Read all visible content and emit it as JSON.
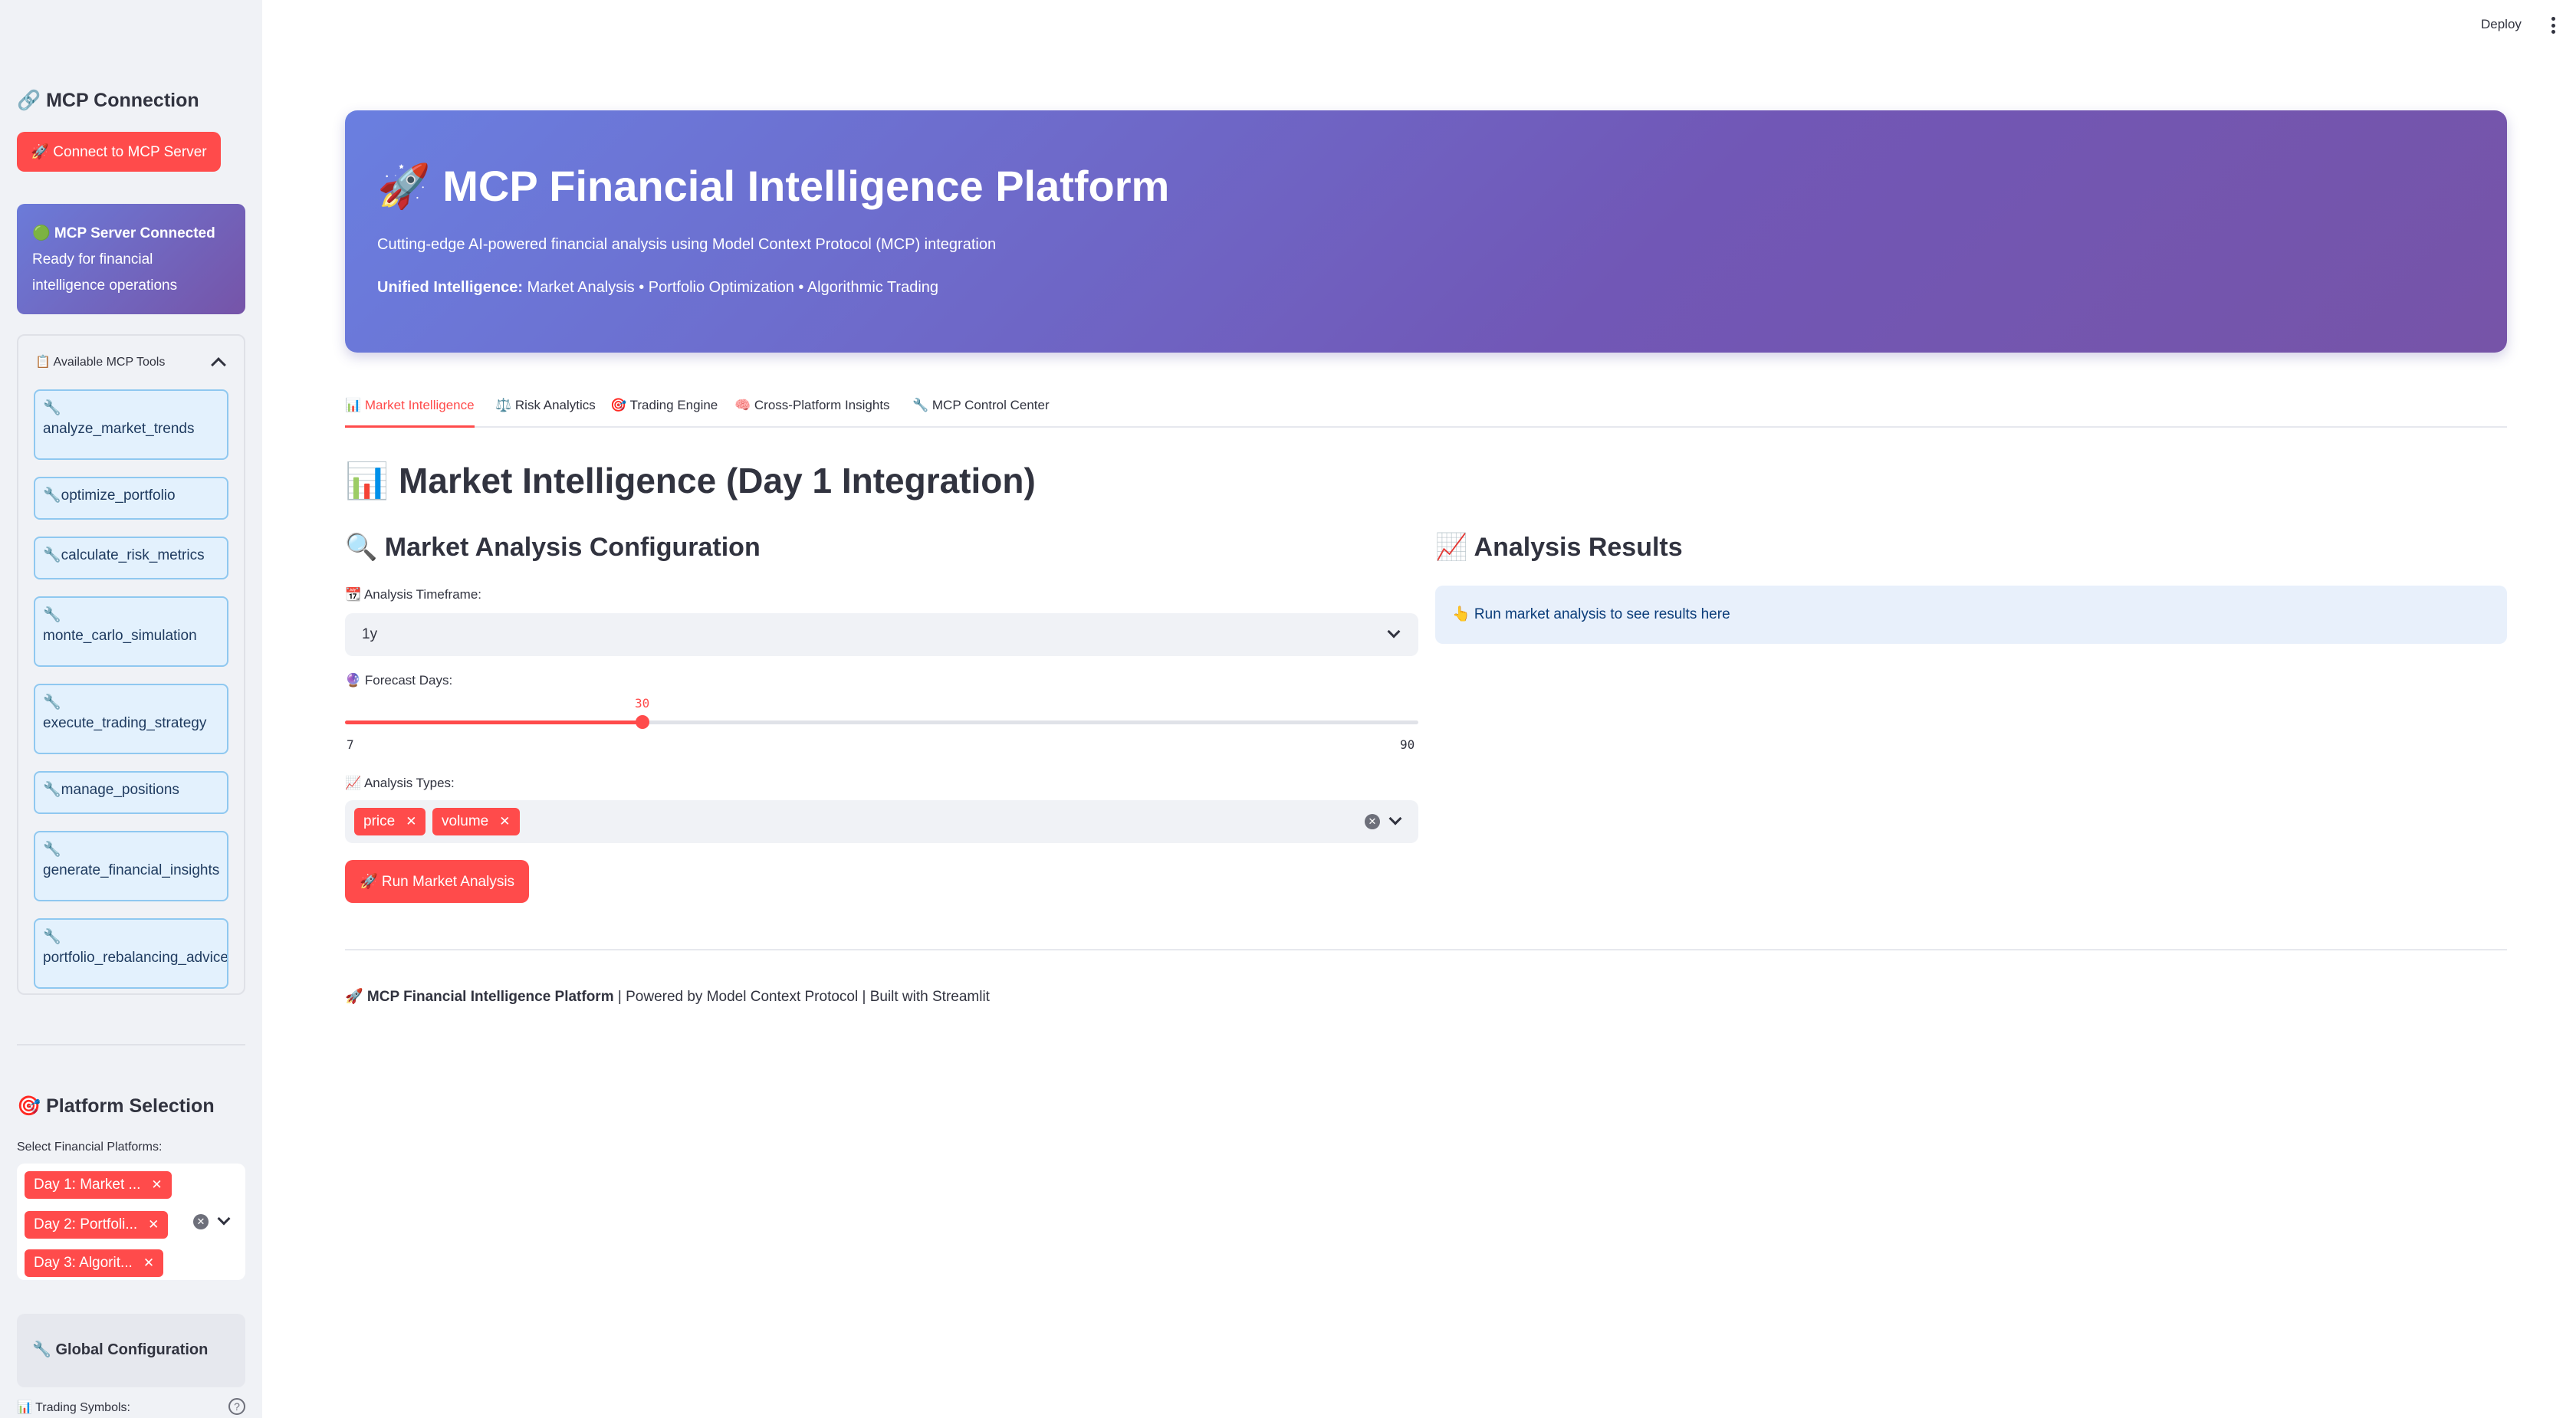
{
  "topbar": {
    "deploy_label": "Deploy"
  },
  "sidebar": {
    "mcp_title": "MCP Connection",
    "mcp_icon": "🔗",
    "connect_button": "🚀 Connect to MCP Server",
    "status": {
      "line1": "🟢 MCP Server Connected",
      "line2": "Ready for financial",
      "line3": "intelligence operations"
    },
    "tools_expander": "📋 Available MCP Tools",
    "tools": [
      {
        "icon": "🔧",
        "name": "analyze_market_trends"
      },
      {
        "icon": "🔧",
        "name": "optimize_portfolio"
      },
      {
        "icon": "🔧",
        "name": "calculate_risk_metrics"
      },
      {
        "icon": "🔧",
        "name": "monte_carlo_simulation"
      },
      {
        "icon": "🔧",
        "name": "execute_trading_strategy"
      },
      {
        "icon": "🔧",
        "name": "manage_positions"
      },
      {
        "icon": "🔧",
        "name": "generate_financial_insights"
      },
      {
        "icon": "🔧",
        "name": "portfolio_rebalancing_advice"
      }
    ],
    "platform_title": "Platform Selection",
    "platform_icon": "🎯",
    "platform_label": "Select Financial Platforms:",
    "platforms": [
      "Day 1: Market ...",
      "Day 2: Portfoli...",
      "Day 3: Algorit..."
    ],
    "global_config": "🔧 Global Configuration",
    "trading_symbols_label": "📊 Trading Symbols:"
  },
  "hero": {
    "title": "🚀 MCP Financial Intelligence Platform",
    "subtitle": "Cutting-edge AI-powered financial analysis using Model Context Protocol (MCP) integration",
    "unified_label": "Unified Intelligence:",
    "unified_text": " Market Analysis • Portfolio Optimization • Algorithmic Trading"
  },
  "tabs": [
    "📊 Market Intelligence",
    "⚖️ Risk Analytics",
    "🎯 Trading Engine",
    "🧠 Cross-Platform Insights",
    "🔧 MCP Control Center"
  ],
  "main": {
    "section_title": "📊 Market Intelligence (Day 1 Integration)",
    "config_title": "🔍 Market Analysis Configuration",
    "results_title": "📈 Analysis Results",
    "timeframe_label": "📆 Analysis Timeframe:",
    "timeframe_value": "1y",
    "forecast_label": "🔮 Forecast Days:",
    "forecast": {
      "value": 30,
      "min": 7,
      "max": 90
    },
    "types_label": "📈 Analysis Types:",
    "types": [
      "price",
      "volume"
    ],
    "run_button": "🚀 Run Market Analysis",
    "results_placeholder": "👆 Run market analysis to see results here"
  },
  "footer": {
    "brand": "🚀 MCP Financial Intelligence Platform",
    "rest": " | Powered by Model Context Protocol | Built with Streamlit"
  },
  "colors": {
    "accent": "#ff4b4b",
    "hero_start": "#6a7fe0",
    "hero_end": "#7654a8",
    "tool_bg": "#e3f1fd",
    "info_bg": "#e8f0fb"
  }
}
